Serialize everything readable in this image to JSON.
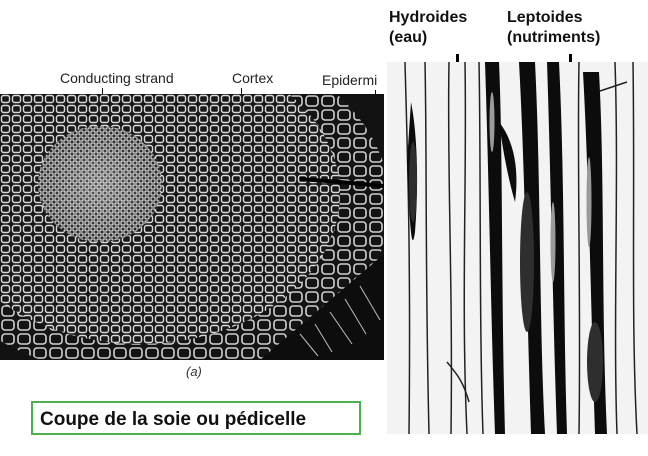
{
  "left_figure": {
    "labels": {
      "conducting_strand": "Conducting strand",
      "cortex": "Cortex",
      "epidermis": "Epidermi"
    },
    "panel_letter": "(a)"
  },
  "right_figure": {
    "hydroides": {
      "line1": "Hydroides",
      "line2": "(eau)"
    },
    "leptoides": {
      "line1": "Leptoides",
      "line2": "(nutriments)"
    }
  },
  "title": "Coupe de la soie ou pédicelle",
  "colors": {
    "title_border": "#4CAF50"
  }
}
